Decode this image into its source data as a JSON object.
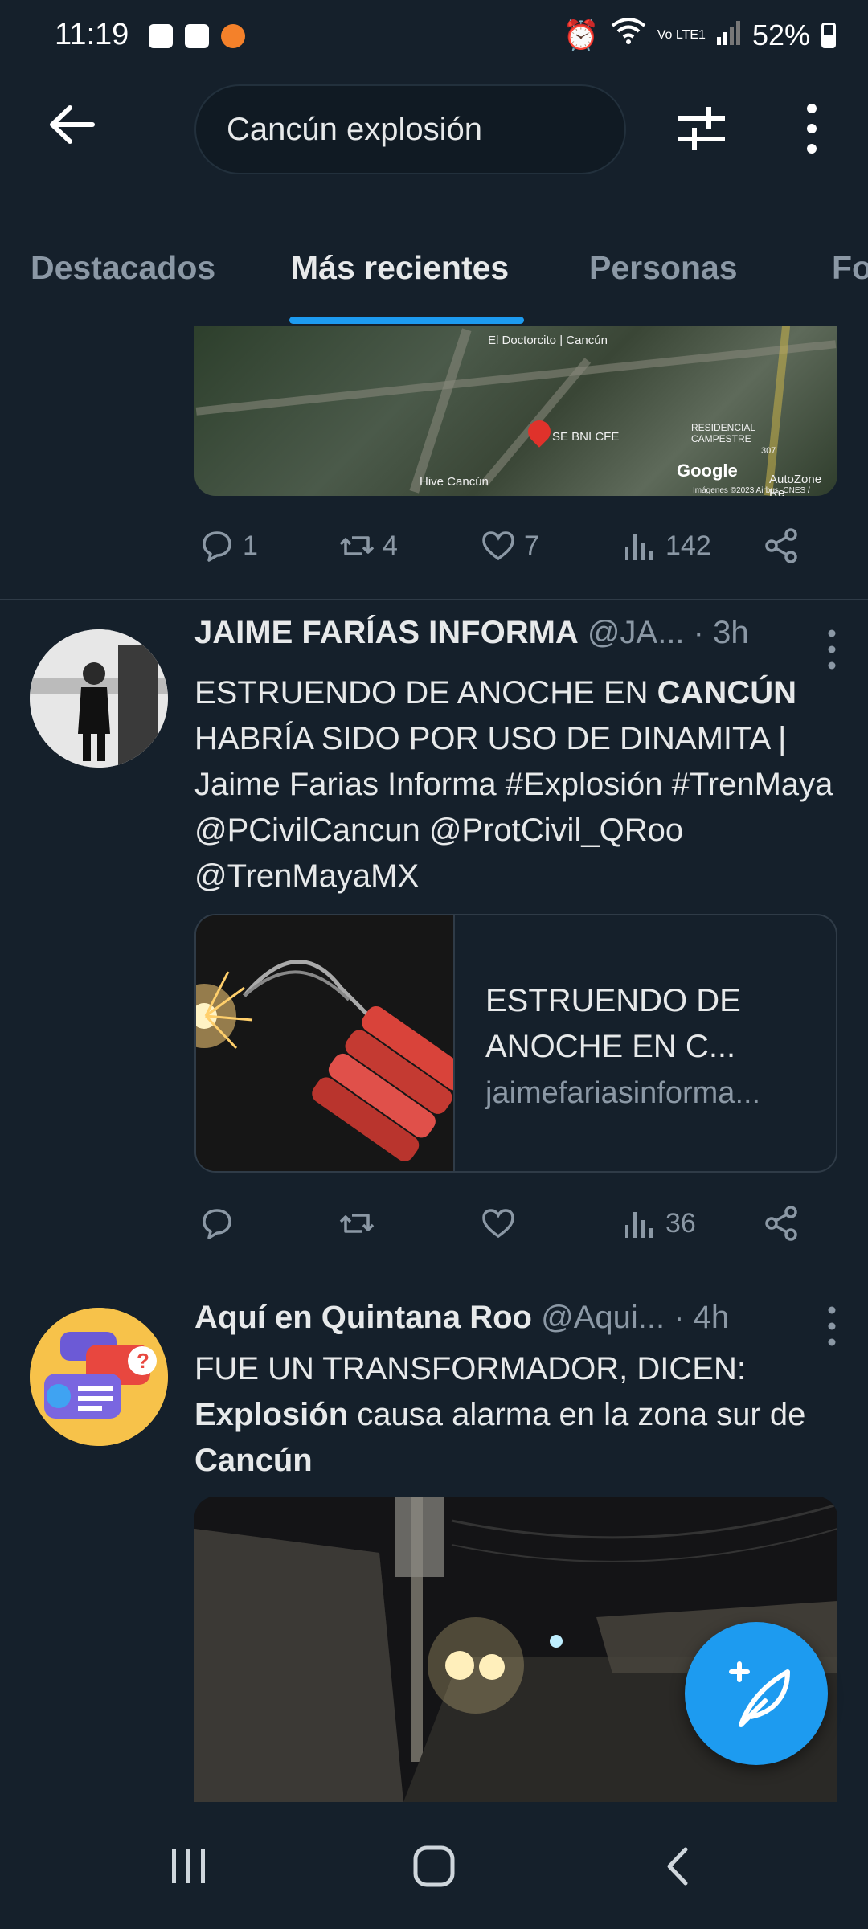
{
  "status_bar": {
    "time": "11:19",
    "battery": "52%",
    "network_label": "Vo LTE1"
  },
  "header": {
    "search_text": "Cancún explosión",
    "icons": [
      "back-arrow-icon",
      "filter-sliders-icon",
      "more-vertical-icon"
    ]
  },
  "tabs": [
    {
      "label": "Destacados",
      "active": false
    },
    {
      "label": "Más recientes",
      "active": true
    },
    {
      "label": "Personas",
      "active": false
    },
    {
      "label": "Fo",
      "active": false
    }
  ],
  "map_card": {
    "labels": [
      "El Doctorcito | Cancún",
      "SE BNI CFE",
      "RESIDENCIAL CAMPESTRE",
      "Hive Cancún",
      "AutoZone Re",
      "Imágenes ©2023 Airbus, CNES /",
      "307"
    ],
    "google": "Google"
  },
  "post0_actions": {
    "reply": "1",
    "retweet": "4",
    "like": "7",
    "views": "142"
  },
  "post1": {
    "name": "JAIME FARÍAS INFORMA",
    "handle": "@JA...",
    "time": "3h",
    "text_line1_pre": "ESTRUENDO DE ANOCHE EN ",
    "text_line1_bold": "CANCÚN",
    "text_rest": "HABRÍA SIDO POR USO DE DINAMITA | Jaime Farias Informa #Explosión #TrenMaya @PCivilCancun @ProtCivil_QRoo @TrenMayaMX",
    "card_title": "ESTRUENDO DE ANOCHE EN C...",
    "card_domain": "jaimefariasinforma...",
    "actions": {
      "reply": "",
      "retweet": "",
      "like": "",
      "views": "36"
    }
  },
  "post2": {
    "name": "Aquí en Quintana Roo",
    "handle": "@Aqui...",
    "time": "4h",
    "text_line1": "FUE UN TRANSFORMADOR, DICEN:",
    "text_bold1": "Explosión",
    "text_mid": " causa alarma en la zona sur de ",
    "text_bold2": "Cancún"
  },
  "colors": {
    "background": "#15202b",
    "accent": "#1d9bf0",
    "text": "#e7e9ea",
    "muted": "#8b98a5"
  }
}
